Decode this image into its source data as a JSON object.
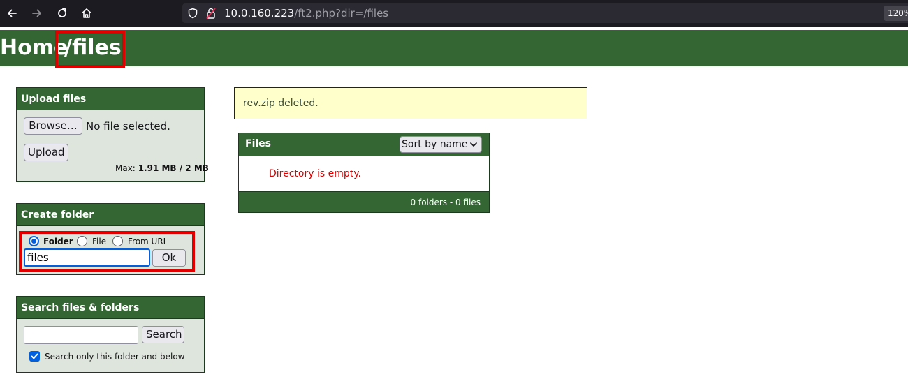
{
  "browser": {
    "url_host": "10.0.160.223",
    "url_path": "/ft2.php?dir=/files",
    "zoom": "120%"
  },
  "header": {
    "home": "Home",
    "dir": "/files"
  },
  "upload": {
    "title": "Upload files",
    "browse_label": "Browse…",
    "no_file": "No file selected.",
    "upload_label": "Upload",
    "max_label": "Max:",
    "max_value": "1.91 MB / 2 MB"
  },
  "create": {
    "title": "Create folder",
    "opt_folder": "Folder",
    "opt_file": "File",
    "opt_url": "From URL",
    "input_value": "files",
    "ok_label": "Ok"
  },
  "search": {
    "title": "Search files & folders",
    "input_value": "",
    "button_label": "Search",
    "checkbox_label": "Search only this folder and below"
  },
  "notice": {
    "text": "rev.zip deleted."
  },
  "files": {
    "title": "Files",
    "sort_selected": "Sort by name",
    "empty_message": "Directory is empty.",
    "footer": "0 folders - 0 files"
  },
  "colors": {
    "header_green": "#336633",
    "panel_bg": "#dde5dd",
    "notice_bg": "#ffffcc",
    "highlight_red": "#e00000",
    "error_red": "#dd0000"
  },
  "icons": [
    "back-arrow-icon",
    "forward-arrow-icon",
    "reload-icon",
    "home-icon",
    "shield-icon",
    "insecure-lock-icon",
    "chevron-down-icon",
    "checkmark-icon"
  ]
}
